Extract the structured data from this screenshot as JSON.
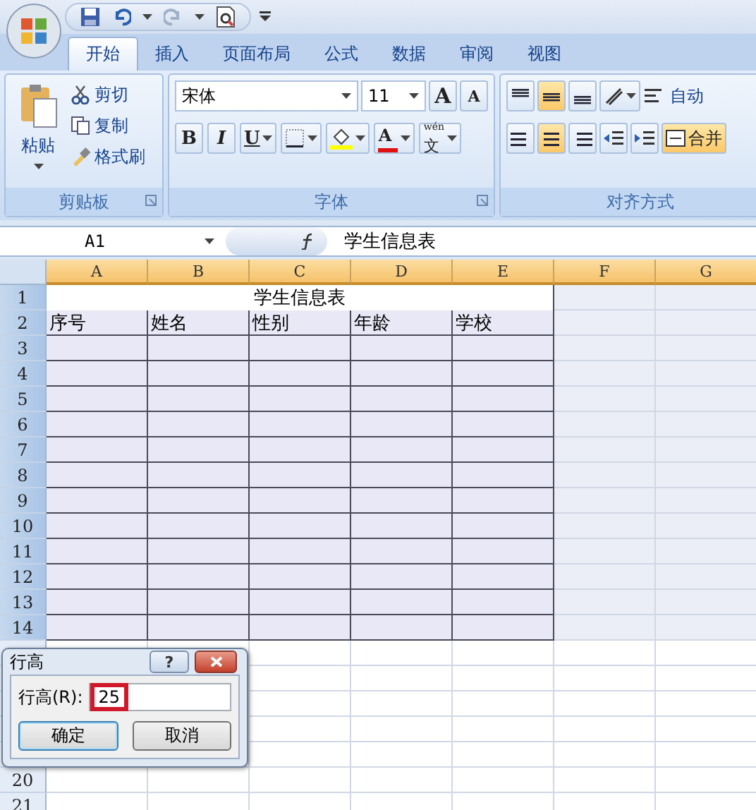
{
  "tabs": [
    {
      "label": "开始",
      "selected": true
    },
    {
      "label": "插入",
      "selected": false
    },
    {
      "label": "页面布局",
      "selected": false
    },
    {
      "label": "公式",
      "selected": false
    },
    {
      "label": "数据",
      "selected": false
    },
    {
      "label": "审阅",
      "selected": false
    },
    {
      "label": "视图",
      "selected": false
    }
  ],
  "clipboard": {
    "title": "剪贴板",
    "paste": "粘贴",
    "items": [
      {
        "kind": "cut",
        "label": "剪切"
      },
      {
        "kind": "copy",
        "label": "复制"
      },
      {
        "kind": "painter",
        "label": "格式刷"
      }
    ]
  },
  "font": {
    "title": "字体",
    "font_name": "宋体",
    "font_size": "11",
    "grow": "A",
    "shrink": "A",
    "bold": "B",
    "italic": "I",
    "underline": "U",
    "font_color": "A",
    "phonetic_top": "wén",
    "phonetic": "文"
  },
  "alignment": {
    "title": "对齐方式",
    "wrap_text": "自动",
    "merge": "合并",
    "merge_selected": true,
    "vertical": [
      {
        "selected": false
      },
      {
        "selected": true
      },
      {
        "selected": false
      }
    ],
    "horizontal": [
      {
        "selected": false
      },
      {
        "selected": true
      },
      {
        "selected": false
      }
    ]
  },
  "formula_bar": {
    "name_box": "A1",
    "formula": "学生信息表"
  },
  "sheet": {
    "columns": [
      "A",
      "B",
      "C",
      "D",
      "E",
      "F",
      "G"
    ],
    "title": "学生信息表",
    "headers": [
      "序号",
      "姓名",
      "性别",
      "年龄",
      "学校"
    ],
    "rows": [
      {
        "number": "1",
        "selected": true
      },
      {
        "number": "2",
        "selected": true
      },
      {
        "number": "3",
        "selected": true
      },
      {
        "number": "4",
        "selected": true
      },
      {
        "number": "5",
        "selected": true
      },
      {
        "number": "6",
        "selected": true
      },
      {
        "number": "7",
        "selected": true
      },
      {
        "number": "8",
        "selected": true
      },
      {
        "number": "9",
        "selected": true
      },
      {
        "number": "10",
        "selected": true
      },
      {
        "number": "11",
        "selected": true
      },
      {
        "number": "12",
        "selected": true
      },
      {
        "number": "13",
        "selected": true
      },
      {
        "number": "14",
        "selected": true
      }
    ],
    "lower_rows": [
      {
        "number": "20",
        "selected": false
      },
      {
        "number": "21",
        "selected": false
      }
    ]
  },
  "dialog": {
    "title": "行高",
    "help": "?",
    "field_label": "行高(R):",
    "value": "25",
    "highlighted": true,
    "buttons": [
      {
        "label": "确定",
        "default": true
      },
      {
        "label": "取消",
        "default": false
      }
    ]
  }
}
